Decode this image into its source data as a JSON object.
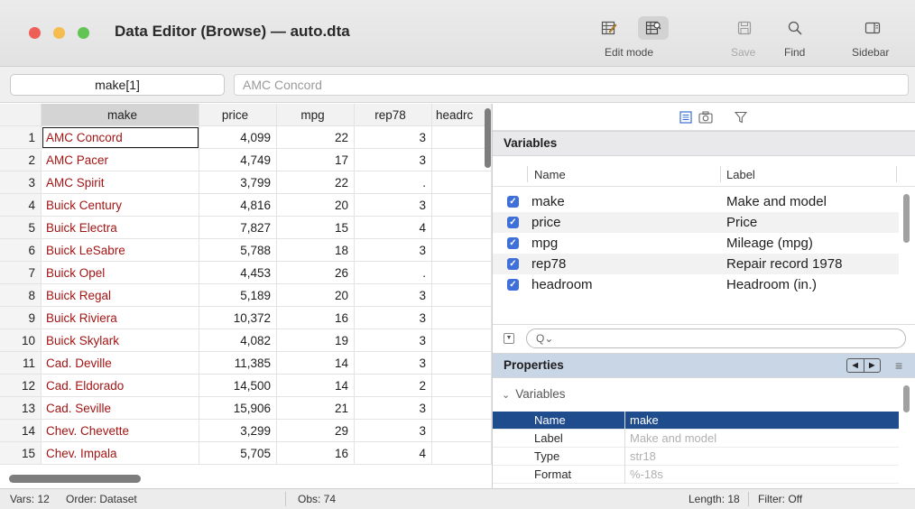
{
  "window": {
    "title": "Data Editor (Browse) — auto.dta",
    "traffic_colors": [
      "#ee5f57",
      "#f5bd4f",
      "#61c454"
    ]
  },
  "toolbar": {
    "edit_mode_label": "Edit mode",
    "save_label": "Save",
    "find_label": "Find",
    "sidebar_label": "Sidebar"
  },
  "cellbar": {
    "name": "make[1]",
    "value": "AMC Concord"
  },
  "grid": {
    "columns": [
      "make",
      "price",
      "mpg",
      "rep78",
      "headrc"
    ],
    "rows": [
      {
        "idx": "1",
        "make": "AMC Concord",
        "price": "4,099",
        "mpg": "22",
        "rep78": "3"
      },
      {
        "idx": "2",
        "make": "AMC Pacer",
        "price": "4,749",
        "mpg": "17",
        "rep78": "3"
      },
      {
        "idx": "3",
        "make": "AMC Spirit",
        "price": "3,799",
        "mpg": "22",
        "rep78": "."
      },
      {
        "idx": "4",
        "make": "Buick Century",
        "price": "4,816",
        "mpg": "20",
        "rep78": "3"
      },
      {
        "idx": "5",
        "make": "Buick Electra",
        "price": "7,827",
        "mpg": "15",
        "rep78": "4"
      },
      {
        "idx": "6",
        "make": "Buick LeSabre",
        "price": "5,788",
        "mpg": "18",
        "rep78": "3"
      },
      {
        "idx": "7",
        "make": "Buick Opel",
        "price": "4,453",
        "mpg": "26",
        "rep78": "."
      },
      {
        "idx": "8",
        "make": "Buick Regal",
        "price": "5,189",
        "mpg": "20",
        "rep78": "3"
      },
      {
        "idx": "9",
        "make": "Buick Riviera",
        "price": "10,372",
        "mpg": "16",
        "rep78": "3"
      },
      {
        "idx": "10",
        "make": "Buick Skylark",
        "price": "4,082",
        "mpg": "19",
        "rep78": "3"
      },
      {
        "idx": "11",
        "make": "Cad. Deville",
        "price": "11,385",
        "mpg": "14",
        "rep78": "3"
      },
      {
        "idx": "12",
        "make": "Cad. Eldorado",
        "price": "14,500",
        "mpg": "14",
        "rep78": "2"
      },
      {
        "idx": "13",
        "make": "Cad. Seville",
        "price": "15,906",
        "mpg": "21",
        "rep78": "3"
      },
      {
        "idx": "14",
        "make": "Chev. Chevette",
        "price": "3,299",
        "mpg": "29",
        "rep78": "3"
      },
      {
        "idx": "15",
        "make": "Chev. Impala",
        "price": "5,705",
        "mpg": "16",
        "rep78": "4"
      }
    ]
  },
  "variables": {
    "title": "Variables",
    "col_name": "Name",
    "col_label": "Label",
    "items": [
      {
        "name": "make",
        "label": "Make and model"
      },
      {
        "name": "price",
        "label": "Price"
      },
      {
        "name": "mpg",
        "label": "Mileage (mpg)"
      },
      {
        "name": "rep78",
        "label": "Repair record 1978"
      },
      {
        "name": "headroom",
        "label": "Headroom (in.)"
      }
    ],
    "filter_placeholder": "Q⌄"
  },
  "properties": {
    "title": "Properties",
    "group": "Variables",
    "rows": [
      {
        "key": "Name",
        "value": "make"
      },
      {
        "key": "Label",
        "value": "Make and model"
      },
      {
        "key": "Type",
        "value": "str18"
      },
      {
        "key": "Format",
        "value": "%-18s"
      }
    ]
  },
  "status": {
    "vars": "Vars: 12",
    "order": "Order: Dataset",
    "obs": "Obs: 74",
    "length": "Length: 18",
    "filter": "Filter: Off"
  }
}
